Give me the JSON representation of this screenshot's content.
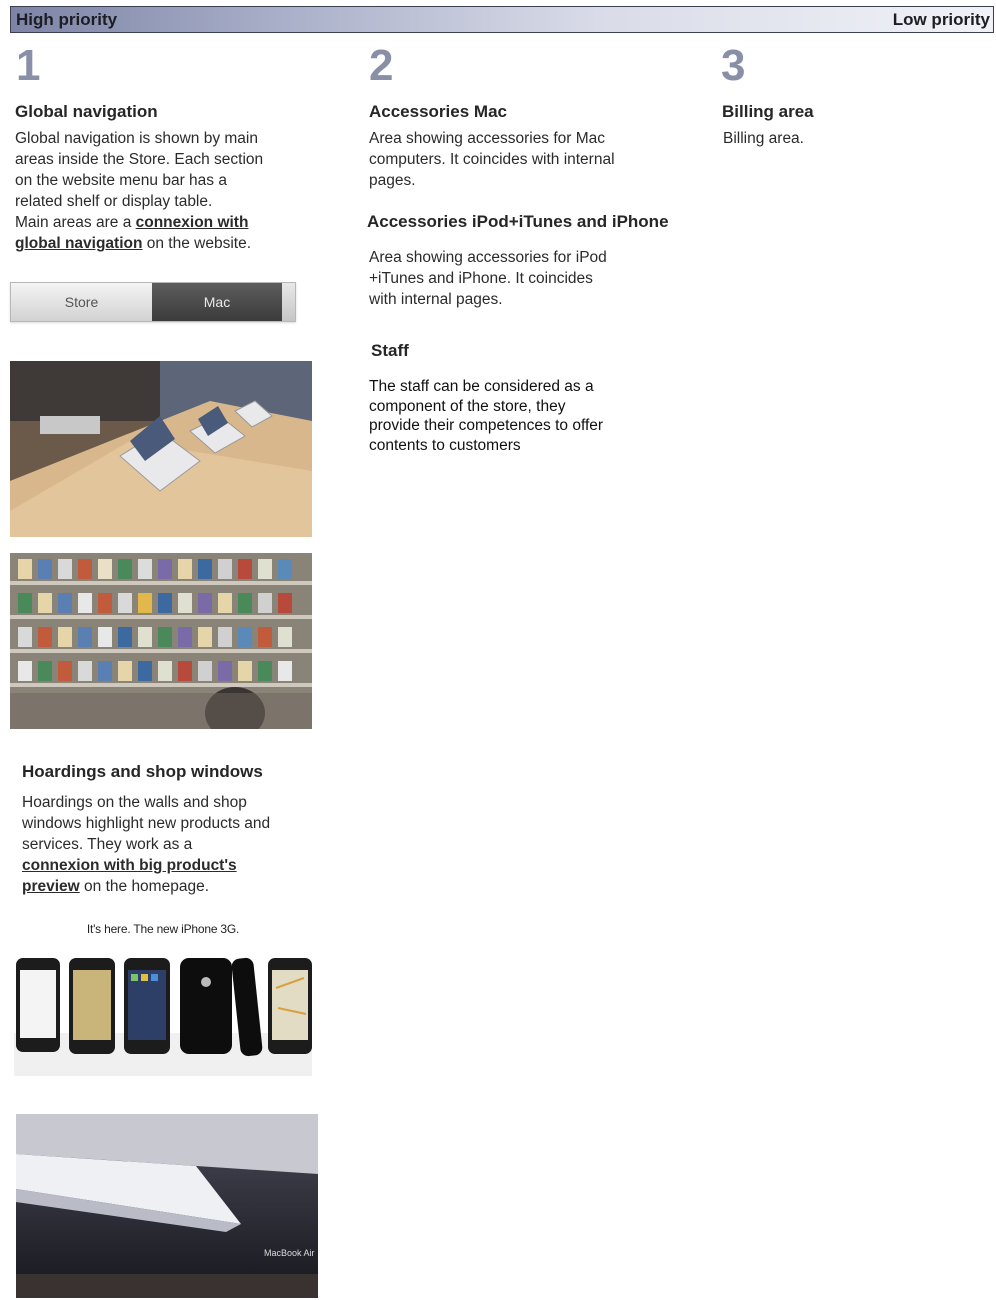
{
  "header": {
    "left_label": "High priority",
    "right_label": "Low priority"
  },
  "columns": [
    {
      "number": "1",
      "title": "Global navigation",
      "text_lines": [
        "Global navigation is shown by main",
        "areas inside the Store. Each section",
        "on the website menu bar has a",
        "related shelf or display table."
      ],
      "link_prefix": "Main areas are a ",
      "link_text_1": "connexion with",
      "link_text_2": "global navigation",
      "link_suffix": " on the website."
    },
    {
      "number": "2",
      "sections": [
        {
          "title": "Accessories Mac",
          "lines": [
            "Area showing accessories for Mac",
            "computers. It coincides with internal",
            "pages."
          ]
        },
        {
          "title": "Accessories iPod+iTunes and iPhone",
          "lines": [
            "Area showing accessories for iPod",
            "+iTunes and iPhone. It coincides",
            "with internal pages."
          ]
        },
        {
          "title": "Staff",
          "lines": [
            "The staff can be considered as a",
            "component of the store, they",
            "provide their competences to offer",
            "contents to customers"
          ]
        }
      ]
    },
    {
      "number": "3",
      "title": "Billing area",
      "text": "Billing area."
    }
  ],
  "nav_tabs": {
    "store_label": "Store",
    "mac_label": "Mac"
  },
  "hoardings": {
    "title": "Hoardings and shop windows",
    "lines": [
      "Hoardings on the walls and shop",
      "windows highlight new products and",
      "services. They work as a"
    ],
    "link_1": "connexion with big product's",
    "link_2": "preview",
    "link_suffix": " on the homepage."
  },
  "iphone_ad": {
    "headline": "It's here. The new iPhone 3G."
  },
  "macbook_banner": {
    "label": "MacBook Air"
  },
  "colors": {
    "bar_dark": "#7d84a6",
    "bar_light": "#f1f2f7",
    "number_gray": "#8a8fa8"
  }
}
